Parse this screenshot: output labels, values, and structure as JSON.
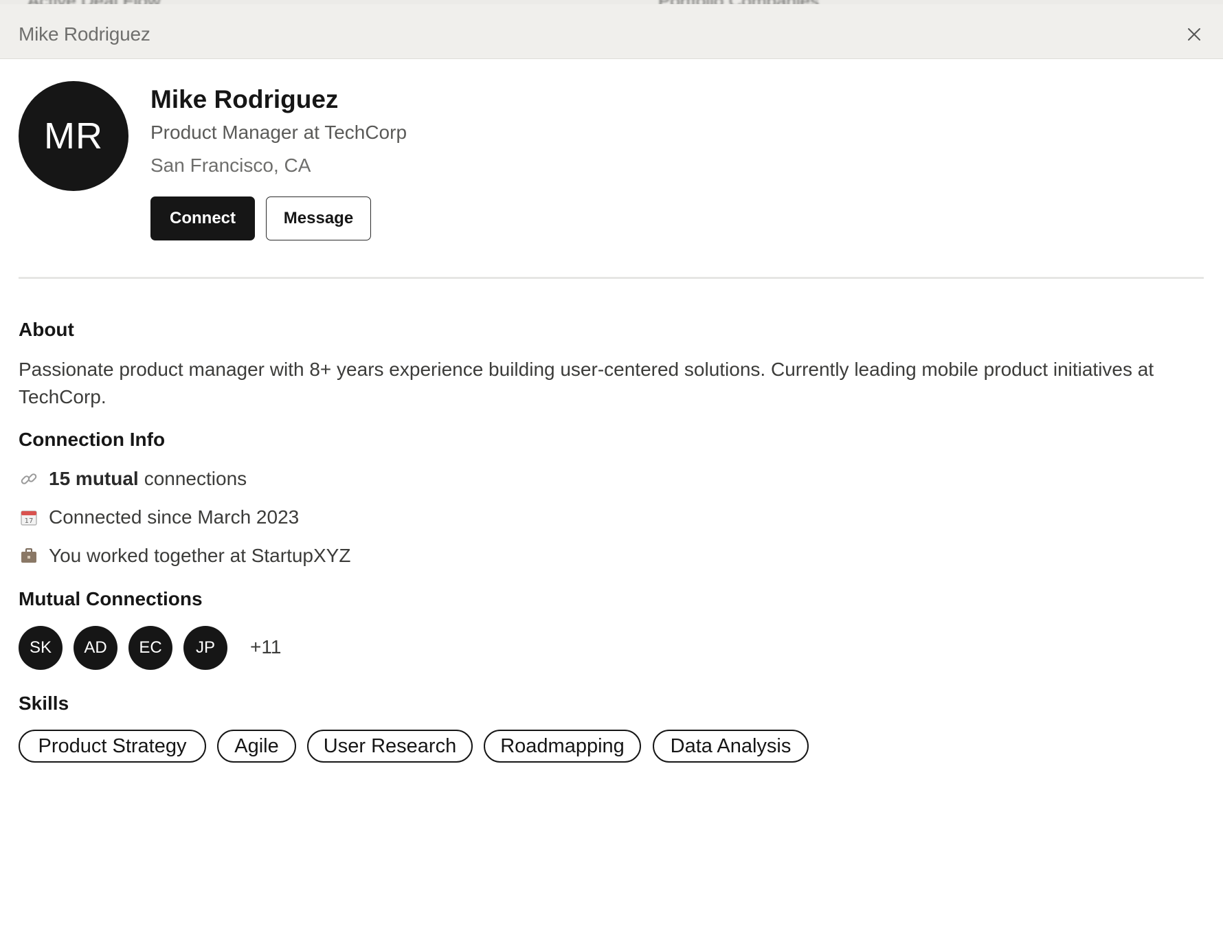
{
  "background": {
    "left_text": "Active Deal Flow",
    "right_text": "Portfolio Companies"
  },
  "header": {
    "title": "Mike Rodriguez",
    "close_icon": "close-icon"
  },
  "profile": {
    "initials": "MR",
    "name": "Mike Rodriguez",
    "role": "Product Manager at TechCorp",
    "location": "San Francisco, CA",
    "connect_label": "Connect",
    "message_label": "Message"
  },
  "about": {
    "title": "About",
    "text": "Passionate product manager with 8+ years experience building user-centered solutions. Currently leading mobile product initiatives at TechCorp."
  },
  "connection_info": {
    "title": "Connection Info",
    "mutual_bold": "15 mutual",
    "mutual_rest": "connections",
    "since": "Connected since March 2023",
    "worked": "You worked together at StartupXYZ",
    "icons": [
      "link-icon",
      "calendar-icon",
      "briefcase-icon"
    ]
  },
  "mutual_connections": {
    "title": "Mutual Connections",
    "avatars": [
      "SK",
      "AD",
      "EC",
      "JP"
    ],
    "more": "+11"
  },
  "skills": {
    "title": "Skills",
    "items": [
      "Product Strategy",
      "Agile",
      "User Research",
      "Roadmapping",
      "Data Analysis"
    ]
  },
  "colors": {
    "primary": "#161616",
    "header_bg": "#f0efec",
    "muted_text": "#6e6e6c"
  }
}
